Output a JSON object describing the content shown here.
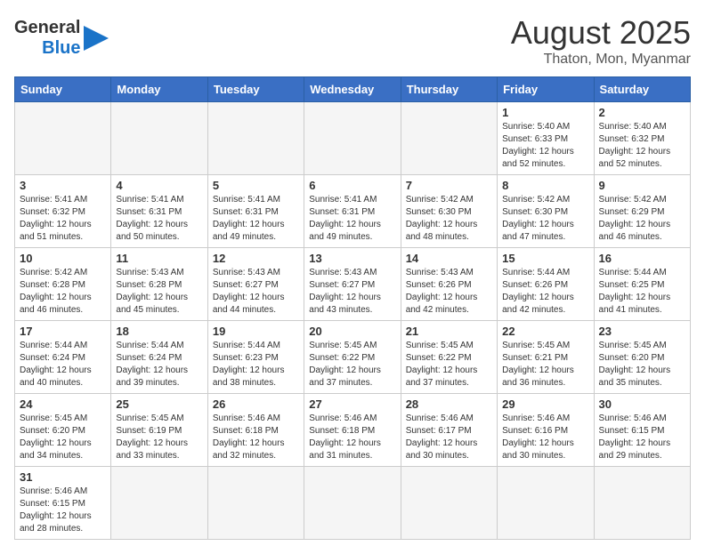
{
  "header": {
    "logo_general": "General",
    "logo_blue": "Blue",
    "month_title": "August 2025",
    "subtitle": "Thaton, Mon, Myanmar"
  },
  "weekdays": [
    "Sunday",
    "Monday",
    "Tuesday",
    "Wednesday",
    "Thursday",
    "Friday",
    "Saturday"
  ],
  "weeks": [
    [
      {
        "day": "",
        "info": ""
      },
      {
        "day": "",
        "info": ""
      },
      {
        "day": "",
        "info": ""
      },
      {
        "day": "",
        "info": ""
      },
      {
        "day": "",
        "info": ""
      },
      {
        "day": "1",
        "info": "Sunrise: 5:40 AM\nSunset: 6:33 PM\nDaylight: 12 hours\nand 52 minutes."
      },
      {
        "day": "2",
        "info": "Sunrise: 5:40 AM\nSunset: 6:32 PM\nDaylight: 12 hours\nand 52 minutes."
      }
    ],
    [
      {
        "day": "3",
        "info": "Sunrise: 5:41 AM\nSunset: 6:32 PM\nDaylight: 12 hours\nand 51 minutes."
      },
      {
        "day": "4",
        "info": "Sunrise: 5:41 AM\nSunset: 6:31 PM\nDaylight: 12 hours\nand 50 minutes."
      },
      {
        "day": "5",
        "info": "Sunrise: 5:41 AM\nSunset: 6:31 PM\nDaylight: 12 hours\nand 49 minutes."
      },
      {
        "day": "6",
        "info": "Sunrise: 5:41 AM\nSunset: 6:31 PM\nDaylight: 12 hours\nand 49 minutes."
      },
      {
        "day": "7",
        "info": "Sunrise: 5:42 AM\nSunset: 6:30 PM\nDaylight: 12 hours\nand 48 minutes."
      },
      {
        "day": "8",
        "info": "Sunrise: 5:42 AM\nSunset: 6:30 PM\nDaylight: 12 hours\nand 47 minutes."
      },
      {
        "day": "9",
        "info": "Sunrise: 5:42 AM\nSunset: 6:29 PM\nDaylight: 12 hours\nand 46 minutes."
      }
    ],
    [
      {
        "day": "10",
        "info": "Sunrise: 5:42 AM\nSunset: 6:28 PM\nDaylight: 12 hours\nand 46 minutes."
      },
      {
        "day": "11",
        "info": "Sunrise: 5:43 AM\nSunset: 6:28 PM\nDaylight: 12 hours\nand 45 minutes."
      },
      {
        "day": "12",
        "info": "Sunrise: 5:43 AM\nSunset: 6:27 PM\nDaylight: 12 hours\nand 44 minutes."
      },
      {
        "day": "13",
        "info": "Sunrise: 5:43 AM\nSunset: 6:27 PM\nDaylight: 12 hours\nand 43 minutes."
      },
      {
        "day": "14",
        "info": "Sunrise: 5:43 AM\nSunset: 6:26 PM\nDaylight: 12 hours\nand 42 minutes."
      },
      {
        "day": "15",
        "info": "Sunrise: 5:44 AM\nSunset: 6:26 PM\nDaylight: 12 hours\nand 42 minutes."
      },
      {
        "day": "16",
        "info": "Sunrise: 5:44 AM\nSunset: 6:25 PM\nDaylight: 12 hours\nand 41 minutes."
      }
    ],
    [
      {
        "day": "17",
        "info": "Sunrise: 5:44 AM\nSunset: 6:24 PM\nDaylight: 12 hours\nand 40 minutes."
      },
      {
        "day": "18",
        "info": "Sunrise: 5:44 AM\nSunset: 6:24 PM\nDaylight: 12 hours\nand 39 minutes."
      },
      {
        "day": "19",
        "info": "Sunrise: 5:44 AM\nSunset: 6:23 PM\nDaylight: 12 hours\nand 38 minutes."
      },
      {
        "day": "20",
        "info": "Sunrise: 5:45 AM\nSunset: 6:22 PM\nDaylight: 12 hours\nand 37 minutes."
      },
      {
        "day": "21",
        "info": "Sunrise: 5:45 AM\nSunset: 6:22 PM\nDaylight: 12 hours\nand 37 minutes."
      },
      {
        "day": "22",
        "info": "Sunrise: 5:45 AM\nSunset: 6:21 PM\nDaylight: 12 hours\nand 36 minutes."
      },
      {
        "day": "23",
        "info": "Sunrise: 5:45 AM\nSunset: 6:20 PM\nDaylight: 12 hours\nand 35 minutes."
      }
    ],
    [
      {
        "day": "24",
        "info": "Sunrise: 5:45 AM\nSunset: 6:20 PM\nDaylight: 12 hours\nand 34 minutes."
      },
      {
        "day": "25",
        "info": "Sunrise: 5:45 AM\nSunset: 6:19 PM\nDaylight: 12 hours\nand 33 minutes."
      },
      {
        "day": "26",
        "info": "Sunrise: 5:46 AM\nSunset: 6:18 PM\nDaylight: 12 hours\nand 32 minutes."
      },
      {
        "day": "27",
        "info": "Sunrise: 5:46 AM\nSunset: 6:18 PM\nDaylight: 12 hours\nand 31 minutes."
      },
      {
        "day": "28",
        "info": "Sunrise: 5:46 AM\nSunset: 6:17 PM\nDaylight: 12 hours\nand 30 minutes."
      },
      {
        "day": "29",
        "info": "Sunrise: 5:46 AM\nSunset: 6:16 PM\nDaylight: 12 hours\nand 30 minutes."
      },
      {
        "day": "30",
        "info": "Sunrise: 5:46 AM\nSunset: 6:15 PM\nDaylight: 12 hours\nand 29 minutes."
      }
    ],
    [
      {
        "day": "31",
        "info": "Sunrise: 5:46 AM\nSunset: 6:15 PM\nDaylight: 12 hours\nand 28 minutes."
      },
      {
        "day": "",
        "info": ""
      },
      {
        "day": "",
        "info": ""
      },
      {
        "day": "",
        "info": ""
      },
      {
        "day": "",
        "info": ""
      },
      {
        "day": "",
        "info": ""
      },
      {
        "day": "",
        "info": ""
      }
    ]
  ]
}
